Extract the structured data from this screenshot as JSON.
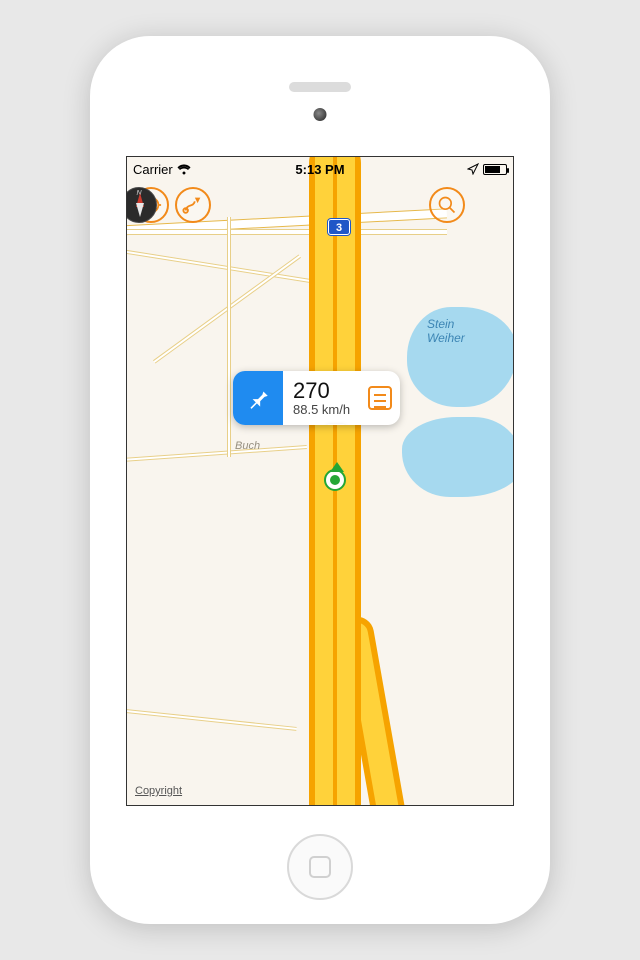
{
  "status_bar": {
    "carrier": "Carrier",
    "time": "5:13 PM"
  },
  "toolbar": {
    "locate_name": "locate",
    "track_name": "route-track",
    "search_name": "search",
    "compass_name": "compass",
    "compass_north": "N"
  },
  "route_shield": {
    "number": "3"
  },
  "water_label": {
    "line1": "Stein",
    "line2": "Weiher"
  },
  "road_labels": {
    "buch": "Buch"
  },
  "info_panel": {
    "heading": "270",
    "speed": "88.5 km/h"
  },
  "footer": {
    "copyright": "Copyright"
  }
}
